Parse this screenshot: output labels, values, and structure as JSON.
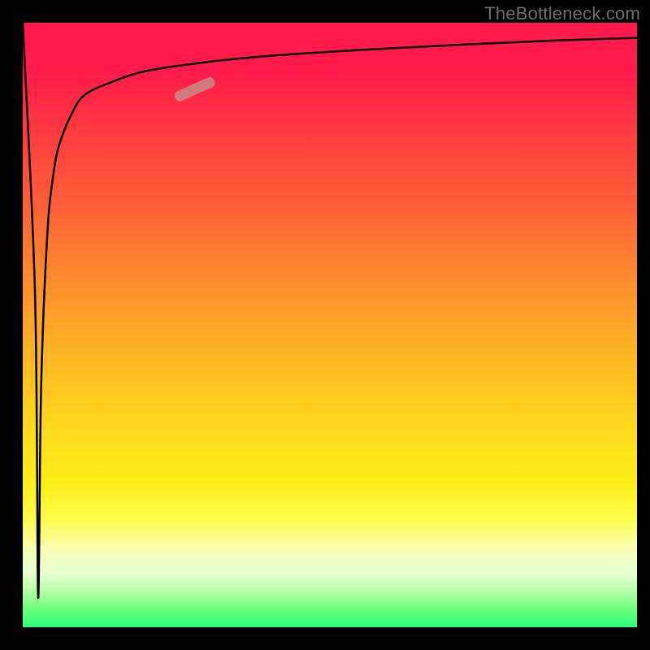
{
  "watermark": "TheBottleneck.com",
  "chart_data": {
    "type": "line",
    "title": "",
    "xlabel": "",
    "ylabel": "",
    "xlim": [
      0,
      100
    ],
    "ylim": [
      0,
      100
    ],
    "series": [
      {
        "name": "bottleneck-curve",
        "x": [
          0,
          2,
          2.5,
          3,
          4,
          5,
          6,
          8,
          10,
          14,
          20,
          30,
          40,
          55,
          70,
          85,
          100
        ],
        "y": [
          100,
          55,
          5,
          40,
          65,
          75,
          80,
          85,
          88,
          90,
          92,
          93.5,
          94.5,
          95.5,
          96.3,
          97,
          97.5
        ]
      }
    ],
    "marker": {
      "center_pct": {
        "x": 28,
        "y": 89
      },
      "length_pct": 7,
      "angle_deg": 24,
      "color": "#c98a86"
    },
    "grid": false,
    "legend": false
  }
}
